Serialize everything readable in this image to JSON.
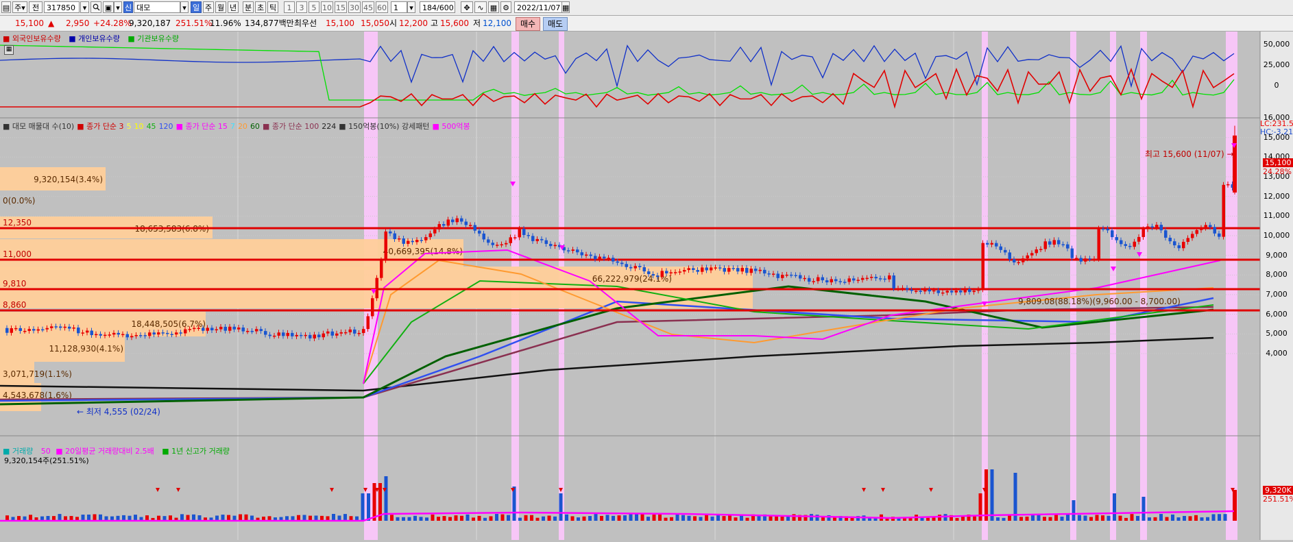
{
  "toolbar": {
    "period_label": "주",
    "prev_label": "전",
    "code": "317850",
    "search_icon": "search-icon",
    "mode_label": "신",
    "name": "대모",
    "tab_active": "일",
    "tabs": [
      "주",
      "월",
      "년",
      "분",
      "초",
      "틱"
    ],
    "intervals": [
      "1",
      "3",
      "5",
      "10",
      "15",
      "30",
      "45",
      "60"
    ],
    "interval_sel": "1",
    "count": "184",
    "count_total": "/600",
    "date": "2022/11/07"
  },
  "info": {
    "price": "15,100",
    "arrow": "▲",
    "change": "2,950",
    "change_pct": "+24.28%",
    "volume": "9,320,187",
    "vol_pct": "251.51%",
    "turnover": "11.96%",
    "amount": "134,877백만",
    "pref_label": "최우선",
    "ask": "15,100",
    "bid": "15,050",
    "open_label": "시",
    "open": "12,200",
    "high_label": "고",
    "high": "15,600",
    "low_label": "저",
    "low": "12,100",
    "buy_label": "매수",
    "sell_label": "매도"
  },
  "holding_legend": {
    "foreign": "외국인보유수량",
    "individual": "개인보유수량",
    "institution": "기관보유수량"
  },
  "holding_axis": [
    "50,000",
    "25,000",
    "0"
  ],
  "price_legend": {
    "items": [
      {
        "text": "대모 매물대 수(10)",
        "color": "#333333"
      },
      {
        "text": "종가 단순 3",
        "color": "#d00000"
      },
      {
        "text": "5",
        "color": "#ffff40"
      },
      {
        "text": "10",
        "color": "#ffff00"
      },
      {
        "text": "45",
        "color": "#10b010"
      },
      {
        "text": "120",
        "color": "#3050f0"
      },
      {
        "text": "종가 단순 15",
        "color": "#ff00ff"
      },
      {
        "text": "7",
        "color": "#40e0ff"
      },
      {
        "text": "20",
        "color": "#ff9a30"
      },
      {
        "text": "60",
        "color": "#006000"
      },
      {
        "text": "종가 단순 100",
        "color": "#8a3050"
      },
      {
        "text": "224",
        "color": "#222222"
      },
      {
        "text": "150억봉(10%) 강세패턴",
        "color": "#333333"
      },
      {
        "text": "500억봉",
        "color": "#ff00ff"
      }
    ]
  },
  "price_axis": [
    "16,000",
    "15,000",
    "14,000",
    "13,000",
    "12,000",
    "11,000",
    "10,000",
    "9,000",
    "8,000",
    "7,000",
    "6,000",
    "5,000",
    "4,000"
  ],
  "price_axis_extra": {
    "lc": "LC:231.5",
    "hc": "HC:-3.21",
    "last": "15,100",
    "last_pct": "24.28%"
  },
  "volume_profile": [
    {
      "label": "9,320,154(3.4%)"
    },
    {
      "label": "0(0.0%)"
    },
    {
      "label": "18,653,583(6.8%)"
    },
    {
      "label": "40,669,395(14.8%)"
    },
    {
      "label": "66,222,979(24.1%)"
    },
    {
      "label": "18,448,505(6.7%)"
    },
    {
      "label": "11,128,930(4.1%)"
    },
    {
      "label": "3,071,719(1.1%)"
    },
    {
      "label": "4,543,678(1.6%)"
    }
  ],
  "hlines": [
    "12,350",
    "11,000",
    "9,810",
    "8,860"
  ],
  "annotations": {
    "high": "최고 15,600 (11/07)",
    "low": "최저 4,555 (02/24)",
    "mid": "9,809.08(88.18%)(9,960.00 - 8,700.00)"
  },
  "volume_legend": {
    "vol": "거래량",
    "ma": "50",
    "ratio": "20일평균 거래량대비 2.5배",
    "newhigh": "1년 신고가 거래량"
  },
  "volume_value": "9,320,154주(251.51%)",
  "volume_axis": {
    "last": "9,320K",
    "pct": "251.51%"
  },
  "colors": {
    "up": "#e80000",
    "down": "#1a55d0",
    "highlight": "#f7c6f7",
    "profile": "#ffcf9a",
    "hline": "#e00000"
  }
}
